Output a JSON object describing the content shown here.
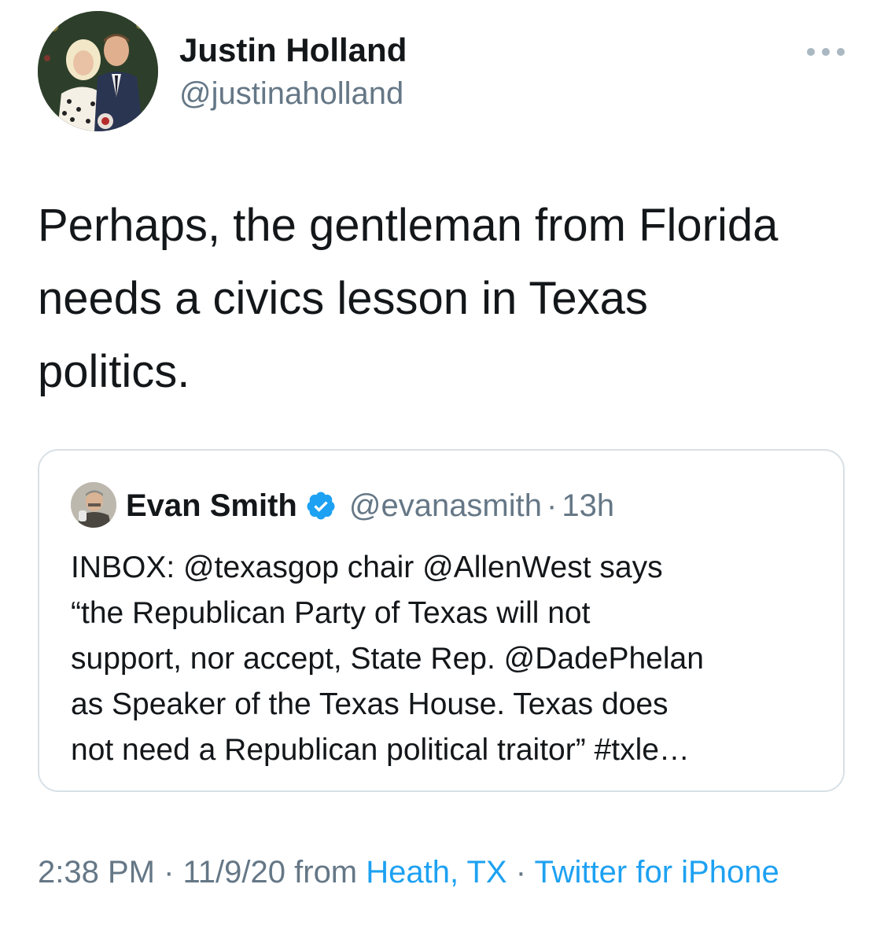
{
  "author": {
    "name": "Justin Holland",
    "handle": "@justinaholland"
  },
  "more_icon": "more-horizontal-icon",
  "tweet_text": "Perhaps, the gentleman from Florida\nneeds a civics lesson in Texas\npolitics.",
  "quoted_tweet": {
    "name": "Evan Smith",
    "verified_icon": "verified-badge-icon",
    "handle": "@evanasmith",
    "separator": "·",
    "time": "13h",
    "text": "INBOX: @texasgop chair @AllenWest says\n“the Republican Party of Texas will not\nsupport, nor accept, State Rep. @DadePhelan\nas Speaker of the Texas House. Texas does\nnot need a Republican political traitor” #txle…"
  },
  "meta": {
    "time": "2:38 PM",
    "sep1": " · ",
    "date": "11/9/20",
    "from_label": " from ",
    "location": "Heath, TX",
    "sep2": " · ",
    "source": "Twitter for iPhone"
  },
  "colors": {
    "link": "#1da1f2",
    "secondary_text": "#657786",
    "verified": "#1da1f2",
    "border": "#d8e0e6"
  }
}
